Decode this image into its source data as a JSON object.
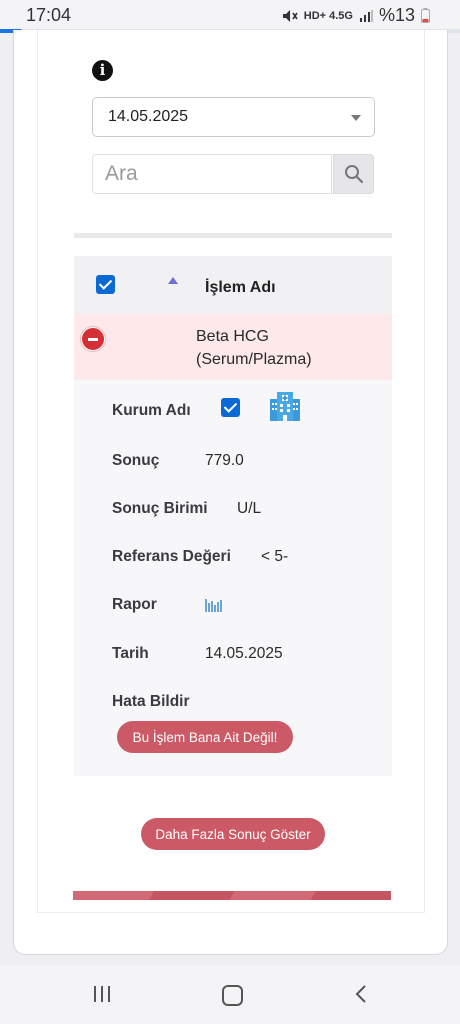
{
  "status_bar": {
    "time": "17:04",
    "icons_text": "HD+ 4.5G",
    "battery": "%13",
    "mute_icon": "mute-icon",
    "signal_icon": "signal-icon"
  },
  "filter": {
    "info_icon": "i",
    "date_selected": "14.05.2025",
    "search_placeholder": "Ara"
  },
  "table": {
    "header_label": "İşlem Adı",
    "header_checked": true,
    "row": {
      "test_name": "Beta HCG (Serum/Plazma)",
      "details": [
        {
          "label": "Kurum Adı"
        },
        {
          "label": "Sonuç",
          "value": "779.0"
        },
        {
          "label": "Sonuç Birimi",
          "value": "U/L"
        },
        {
          "label": "Referans Değeri",
          "value": "< 5-"
        },
        {
          "label": "Rapor"
        },
        {
          "label": "Tarih",
          "value": "14.05.2025"
        },
        {
          "label": "Hata Bildir"
        }
      ],
      "report_error_button": "Bu İşlem Bana Ait Değil!"
    }
  },
  "more_button": "Daha Fazla Sonuç Göster",
  "colors": {
    "accent_blue": "#0b69d4",
    "row_highlight": "#fde8ea",
    "button_red": "#cb5966",
    "collapse_red": "#d42f34"
  }
}
